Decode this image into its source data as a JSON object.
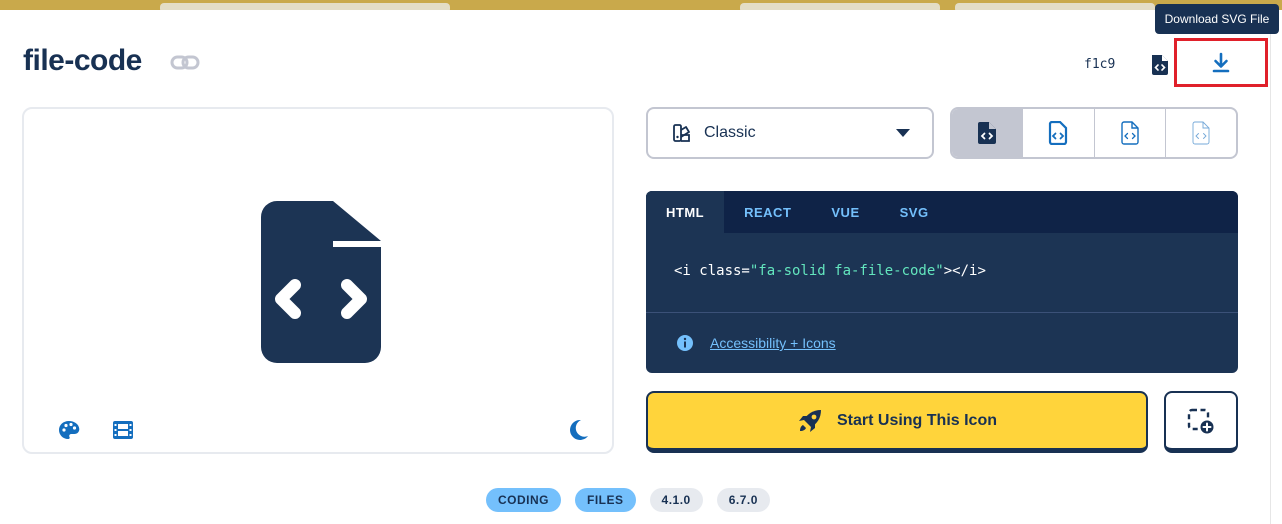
{
  "icon": {
    "name": "file-code",
    "unicode": "f1c9"
  },
  "tooltip": {
    "text": "Download SVG File"
  },
  "style_select": {
    "selected": "Classic"
  },
  "variants": [
    "solid",
    "regular",
    "light",
    "thin"
  ],
  "code_panel": {
    "tabs": [
      "HTML",
      "REACT",
      "VUE",
      "SVG"
    ],
    "active_tab": "HTML",
    "snippet": {
      "open": "<i class=",
      "value": "\"fa-solid fa-file-code\"",
      "close": "></i>"
    },
    "accessibility_link": "Accessibility + Icons"
  },
  "actions": {
    "start_label": "Start Using This Icon"
  },
  "tags": {
    "categories": [
      "CODING",
      "FILES"
    ],
    "versions": [
      "4.1.0",
      "6.7.0"
    ]
  },
  "colors": {
    "navy": "#183153",
    "accent_blue": "#146ebe",
    "yellow": "#ffd43b",
    "highlight_red": "#e0202a"
  }
}
